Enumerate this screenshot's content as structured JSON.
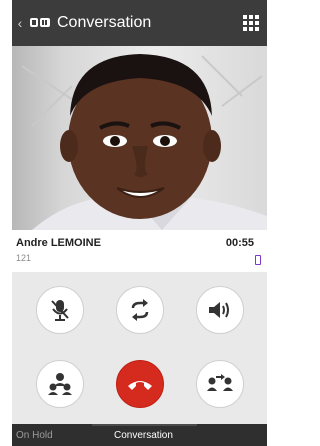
{
  "header": {
    "back_icon": "chevron-left-icon",
    "app_icon": "conversation-app-icon",
    "title": "Conversation",
    "menu_icon": "grid-icon"
  },
  "caller": {
    "name": "Andre LEMOINE",
    "number": "121",
    "duration": "00:55",
    "device_icon": "mobile-device-icon",
    "device_color": "#7a3bc9"
  },
  "controls": [
    {
      "name": "mute",
      "icon": "microphone-muted-icon"
    },
    {
      "name": "swap",
      "icon": "swap-arrows-icon"
    },
    {
      "name": "speaker",
      "icon": "speaker-icon"
    },
    {
      "name": "conference",
      "icon": "conference-icon"
    },
    {
      "name": "hangup",
      "icon": "phone-hangup-icon",
      "color": "#d52b1e"
    },
    {
      "name": "transfer",
      "icon": "transfer-icon"
    }
  ],
  "tabs": {
    "on_hold": "On Hold",
    "conversation": "Conversation"
  }
}
